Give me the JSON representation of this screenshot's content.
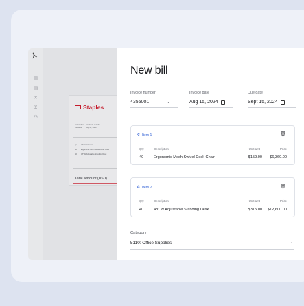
{
  "app": {
    "rail_icons": [
      "chart-icon",
      "receipt-icon",
      "close-icon",
      "cart-icon",
      "users-icon"
    ]
  },
  "document_preview": {
    "vendor": "Staples",
    "meta_labels": [
      "INVOICE #",
      "DATE OF ISSUE"
    ],
    "meta_values": [
      "4355001",
      "July 31, 2024"
    ],
    "table_headers": [
      "QTY",
      "DESCRIPTION"
    ],
    "rows": [
      {
        "qty": "40",
        "description": "Ergonomic Mesh Swivel Desk Chair"
      },
      {
        "qty": "40",
        "description": "48\" W Adjustable Standing Desk"
      }
    ],
    "total_label": "Total Amount (USD)"
  },
  "bill": {
    "title": "New bill",
    "invoice_number": {
      "label": "Invoice number",
      "value": "4355001"
    },
    "invoice_date": {
      "label": "Invoice date",
      "value": "Aug 15, 2024"
    },
    "due_date": {
      "label": "Due date",
      "value": "Sept 15, 2024"
    },
    "columns": {
      "qty": "Qty",
      "description": "Description",
      "unit": "Unit amt",
      "price": "Price"
    },
    "items": [
      {
        "name": "Item 1",
        "qty": "40",
        "description": "Ergonomic Mesh Swivel Desk Chair",
        "unit": "$159.00",
        "price": "$6,360.00"
      },
      {
        "name": "Item 2",
        "qty": "40",
        "description": "48\" W Adjustable Standing Desk",
        "unit": "$315.00",
        "price": "$12,600.00"
      }
    ],
    "category": {
      "label": "Category",
      "value": "5110: Office Supplies"
    }
  },
  "colors": {
    "accent": "#3d6ad8",
    "brand": "#c41b2b"
  }
}
